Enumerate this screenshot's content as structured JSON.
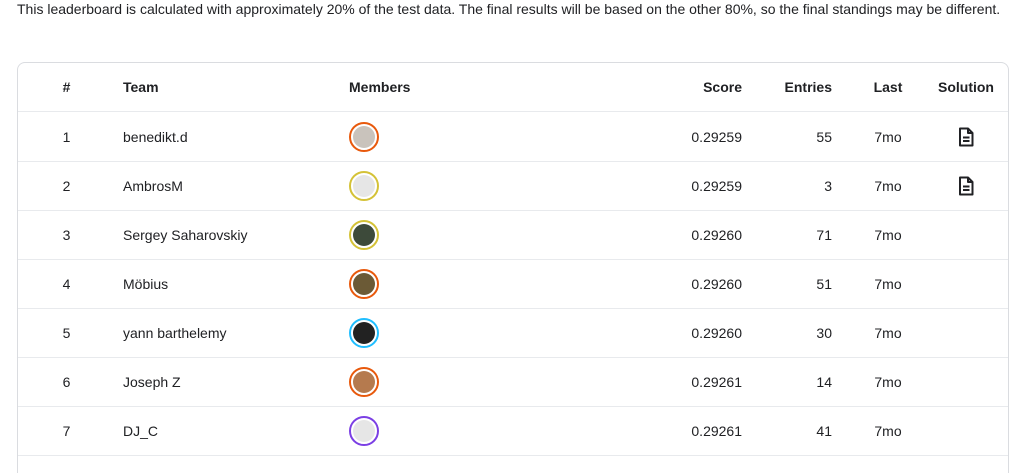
{
  "notice": "This leaderboard is calculated with approximately 20% of the test data. The final results will be based on the other 80%, so the final standings may be different.",
  "columns": {
    "rank": "#",
    "team": "Team",
    "members": "Members",
    "score": "Score",
    "entries": "Entries",
    "last": "Last",
    "solution": "Solution"
  },
  "rows": [
    {
      "rank": "1",
      "team": "benedikt.d",
      "score": "0.29259",
      "entries": "55",
      "last": "7mo",
      "solution": true,
      "avatar_ring": "#e8590c",
      "avatar_fill": "#c9c3bc"
    },
    {
      "rank": "2",
      "team": "AmbrosM",
      "score": "0.29259",
      "entries": "3",
      "last": "7mo",
      "solution": true,
      "avatar_ring": "#d4c237",
      "avatar_fill": "#e6e6e6"
    },
    {
      "rank": "3",
      "team": "Sergey Saharovskiy",
      "score": "0.29260",
      "entries": "71",
      "last": "7mo",
      "solution": false,
      "avatar_ring": "#d4c237",
      "avatar_fill": "#3d4a3a"
    },
    {
      "rank": "4",
      "team": "Möbius",
      "score": "0.29260",
      "entries": "51",
      "last": "7mo",
      "solution": false,
      "avatar_ring": "#e8590c",
      "avatar_fill": "#6b5a36"
    },
    {
      "rank": "5",
      "team": "yann barthelemy",
      "score": "0.29260",
      "entries": "30",
      "last": "7mo",
      "solution": false,
      "avatar_ring": "#20beff",
      "avatar_fill": "#222222"
    },
    {
      "rank": "6",
      "team": "Joseph Z",
      "score": "0.29261",
      "entries": "14",
      "last": "7mo",
      "solution": false,
      "avatar_ring": "#e8590c",
      "avatar_fill": "#b57a4e"
    },
    {
      "rank": "7",
      "team": "DJ_C",
      "score": "0.29261",
      "entries": "41",
      "last": "7mo",
      "solution": false,
      "avatar_ring": "#7b3fe4",
      "avatar_fill": "#e6e6e6"
    }
  ],
  "icons": {
    "solution": "document-icon"
  }
}
